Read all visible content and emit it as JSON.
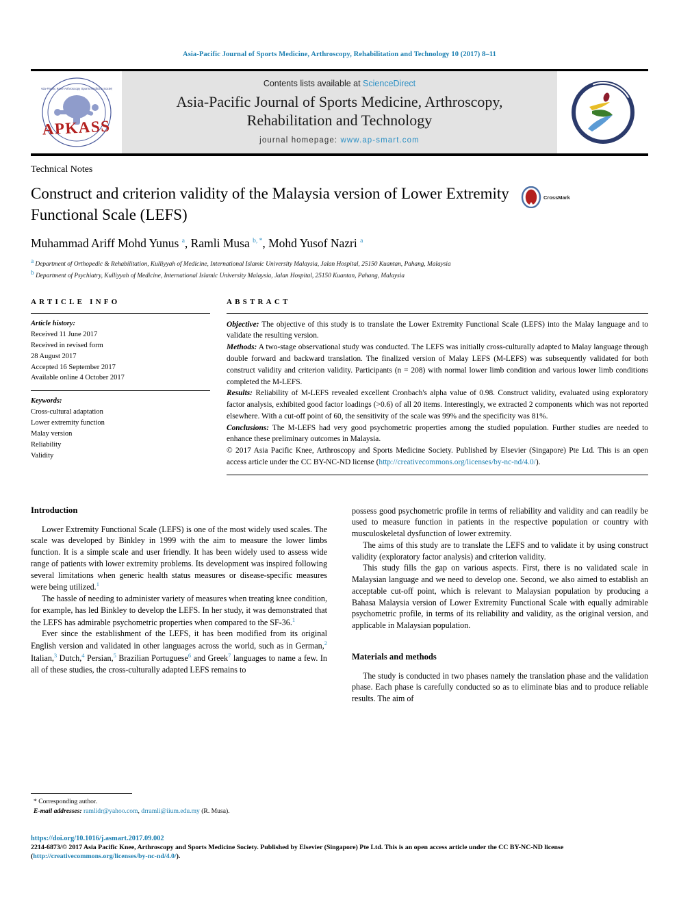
{
  "running_head": "Asia-Pacific Journal of Sports Medicine, Arthroscopy, Rehabilitation and Technology 10 (2017) 8–11",
  "masthead": {
    "contents_prefix": "Contents lists available at ",
    "sciencedirect": "ScienceDirect",
    "journal_title_line1": "Asia-Pacific Journal of Sports Medicine, Arthroscopy,",
    "journal_title_line2": "Rehabilitation and Technology",
    "homepage_prefix": "journal homepage: ",
    "homepage_url": "www.ap-smart.com",
    "left_logo_name": "APKASS",
    "right_logo_name": "ap-smart"
  },
  "article": {
    "kind": "Technical Notes",
    "title": "Construct and criterion validity of the Malaysia version of Lower Extremity Functional Scale (LEFS)",
    "crossmark_label": "CrossMark",
    "authors_html": "Muhammad Ariff Mohd Yunus <sup>a</sup>, Ramli Musa <sup>b, *</sup>, Mohd Yusof Nazri <sup>a</sup>",
    "affiliation_a": "Department of Orthopedic & Rehabilitation, Kulliyyah of Medicine, International Islamic University Malaysia, Jalan Hospital, 25150 Kuantan, Pahang, Malaysia",
    "affiliation_b": "Department of Psychiatry, Kulliyyah of Medicine, International Islamic University Malaysia, Jalan Hospital, 25150 Kuantan, Pahang, Malaysia",
    "aff_marker_a": "a",
    "aff_marker_b": "b"
  },
  "article_info": {
    "label": "ARTICLE INFO",
    "history_header": "Article history:",
    "history": [
      "Received 11 June 2017",
      "Received in revised form",
      "28 August 2017",
      "Accepted 16 September 2017",
      "Available online 4 October 2017"
    ],
    "keywords_header": "Keywords:",
    "keywords": [
      "Cross-cultural adaptation",
      "Lower extremity function",
      "Malay version",
      "Reliability",
      "Validity"
    ]
  },
  "abstract": {
    "label": "ABSTRACT",
    "objective_label": "Objective:",
    "objective_text": " The objective of this study is to translate the Lower Extremity Functional Scale (LEFS) into the Malay language and to validate the resulting version.",
    "methods_label": "Methods:",
    "methods_text": " A two-stage observational study was conducted. The LEFS was initially cross-culturally adapted to Malay language through double forward and backward translation. The finalized version of Malay LEFS (M-LEFS) was subsequently validated for both construct validity and criterion validity. Participants (n = 208) with normal lower limb condition and various lower limb conditions completed the M-LEFS.",
    "results_label": "Results:",
    "results_text": " Reliability of M-LEFS revealed excellent Cronbach's alpha value of 0.98. Construct validity, evaluated using exploratory factor analysis, exhibited good factor loadings (>0.6) of all 20 items. Interestingly, we extracted 2 components which was not reported elsewhere. With a cut-off point of 60, the sensitivity of the scale was 99% and the specificity was 81%.",
    "conclusions_label": "Conclusions:",
    "conclusions_text": " The M-LEFS had very good psychometric properties among the studied population. Further studies are needed to enhance these preliminary outcomes in Malaysia.",
    "copyright_text": "© 2017 Asia Pacific Knee, Arthroscopy and Sports Medicine Society. Published by Elsevier (Singapore) Pte Ltd. This is an open access article under the CC BY-NC-ND license (",
    "copyright_link": "http://creativecommons.org/licenses/by-nc-nd/4.0/",
    "copyright_tail": ")."
  },
  "body": {
    "left_heading": "Introduction",
    "left_p1": "Lower Extremity Functional Scale (LEFS) is one of the most widely used scales. The scale was developed by Binkley in 1999 with the aim to measure the lower limbs function. It is a simple scale and user friendly. It has been widely used to assess wide range of patients with lower extremity problems. Its development was inspired following several limitations when generic health status measures or disease-specific measures were being utilized.",
    "left_p1_ref": "1",
    "left_p2": "The hassle of needing to administer variety of measures when treating knee condition, for example, has led Binkley to develop the LEFS. In her study, it was demonstrated that the LEFS has admirable psychometric properties when compared to the SF-36.",
    "left_p2_ref": "1",
    "left_p3_a": "Ever since the establishment of the LEFS, it has been modified from its original English version and validated in other languages across the world, such as in German,",
    "left_p3_r1": "2",
    "left_p3_b": " Italian,",
    "left_p3_r2": "3",
    "left_p3_c": " Dutch,",
    "left_p3_r3": "4",
    "left_p3_d": " Persian,",
    "left_p3_r4": "5",
    "left_p3_e": " Brazilian Portuguese",
    "left_p3_r5": "6",
    "left_p3_f": " and Greek",
    "left_p3_r6": "7",
    "left_p3_g": " languages to name a few. In all of these studies, the cross-culturally adapted LEFS remains to",
    "right_p1": "possess good psychometric profile in terms of reliability and validity and can readily be used to measure function in patients in the respective population or country with musculoskeletal dysfunction of lower extremity.",
    "right_p2": "The aims of this study are to translate the LEFS and to validate it by using construct validity (exploratory factor analysis) and criterion validity.",
    "right_p3": "This study fills the gap on various aspects. First, there is no validated scale in Malaysian language and we need to develop one. Second, we also aimed to establish an acceptable cut-off point, which is relevant to Malaysian population by producing a Bahasa Malaysia version of Lower Extremity Functional Scale with equally admirable psychometric profile, in terms of its reliability and validity, as the original version, and applicable in Malaysian population.",
    "right_heading": "Materials and methods",
    "right_p4": "The study is conducted in two phases namely the translation phase and the validation phase. Each phase is carefully conducted so as to eliminate bias and to produce reliable results. The aim of"
  },
  "footnote": {
    "corresponding": "* Corresponding author.",
    "email_label": "E-mail addresses:",
    "email1": "ramlidr@yahoo.com",
    "email_sep": ", ",
    "email2": "drramli@iium.edu.my",
    "email_tail": " (R. Musa)."
  },
  "footer": {
    "doi": "https://doi.org/10.1016/j.asmart.2017.09.002",
    "issn_line": "2214-6873/© 2017 Asia Pacific Knee, Arthroscopy and Sports Medicine Society. Published by Elsevier (Singapore) Pte Ltd. This is an open access article under the CC BY-NC-ND license (",
    "license_link": "http://creativecommons.org/licenses/by-nc-nd/4.0/",
    "issn_tail": ")."
  },
  "colors": {
    "link_blue": "#1a7eb0",
    "sciencedirect_blue": "#2b8fc4",
    "banner_grey": "#e3e3e3",
    "crossmark_red": "#b3201f"
  }
}
